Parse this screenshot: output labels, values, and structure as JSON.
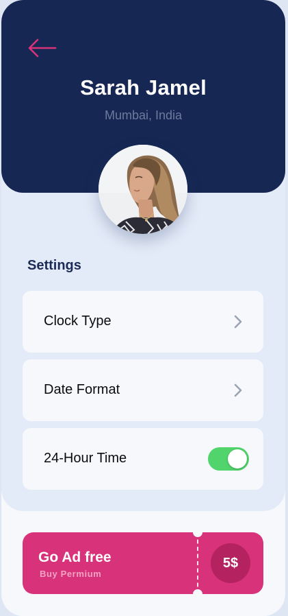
{
  "header": {
    "back_icon": "arrow-left-icon",
    "name": "Sarah Jamel",
    "location": "Mumbai, India",
    "avatar": "profile-photo"
  },
  "settings": {
    "title": "Settings",
    "items": [
      {
        "label": "Clock Type",
        "control": "chevron-right-icon"
      },
      {
        "label": "Date Format",
        "control": "chevron-right-icon"
      },
      {
        "label": "24-Hour Time",
        "control": "toggle",
        "enabled": true
      }
    ]
  },
  "promo": {
    "title": "Go Ad free",
    "subtitle": "Buy Permium",
    "price": "5$"
  },
  "colors": {
    "header_bg": "#162753",
    "accent": "#d8327a",
    "toggle_on": "#51d46c",
    "page_bg": "#e4ebf8"
  }
}
